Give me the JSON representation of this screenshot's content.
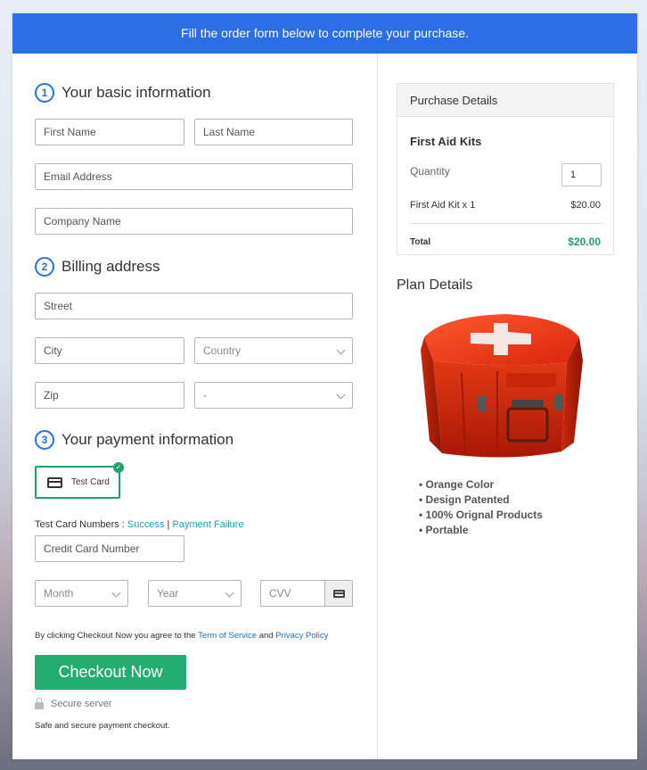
{
  "banner": {
    "text": "Fill the order form below to complete your purchase."
  },
  "basic_info": {
    "step": "1",
    "title": "Your basic information",
    "first_name_placeholder": "First Name",
    "last_name_placeholder": "Last Name",
    "email_placeholder": "Email Address",
    "company_placeholder": "Company Name"
  },
  "billing": {
    "step": "2",
    "title": "Billing address",
    "street_placeholder": "Street",
    "city_placeholder": "City",
    "country_label": "Country",
    "zip_placeholder": "Zip",
    "state_label": "-"
  },
  "payment": {
    "step": "3",
    "title": "Your payment information",
    "card_option": "Test Card",
    "test_numbers_label": "Test Card Numbers : ",
    "success_link": "Success",
    "separator": " | ",
    "failure_link": "Payment Failure",
    "card_number_placeholder": "Credit Card Number",
    "month_label": "Month",
    "year_label": "Year",
    "cvv_placeholder": "CVV"
  },
  "footer": {
    "agree_prefix": "By clicking Checkout Now you agree to the ",
    "terms_link": "Term of Service",
    "agree_and": " and ",
    "privacy_link": "Privacy Policy",
    "checkout_label": "Checkout Now",
    "secure_label": "Secure server",
    "safe_text": "Safe and secure payment checkout."
  },
  "purchase": {
    "header": "Purchase Details",
    "product_name": "First Aid Kits",
    "quantity_label": "Quantity",
    "quantity_value": "1",
    "line_item": "First Aid Kit x 1",
    "line_price": "$20.00",
    "total_label": "Total",
    "total_value": "$20.00"
  },
  "plan": {
    "title": "Plan Details",
    "features": [
      "Orange Color",
      "Design Patented",
      "100% Orignal Products",
      "Portable"
    ]
  },
  "colors": {
    "banner": "#2a6fe5",
    "accent_green": "#23ad70",
    "link_teal": "#1aa2b0",
    "link_blue": "#1a6fc9"
  },
  "icons": [
    "card-icon",
    "check-icon",
    "cvv-card-icon",
    "lock-icon",
    "chevron-down-icon"
  ]
}
